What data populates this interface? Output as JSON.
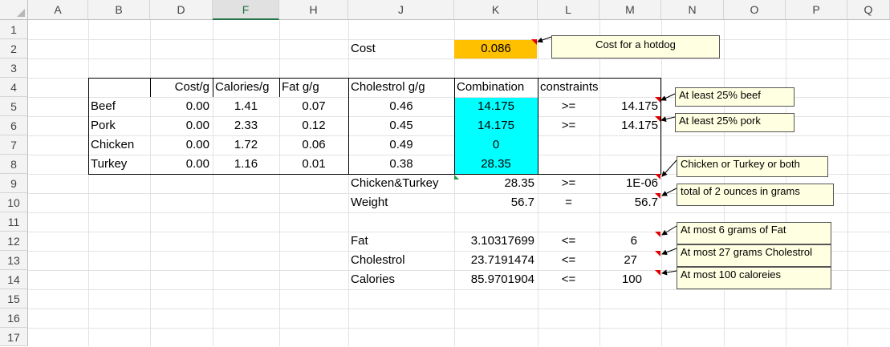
{
  "columns": [
    "A",
    "B",
    "D",
    "F",
    "H",
    "J",
    "K",
    "L",
    "M",
    "N",
    "O",
    "P",
    "Q"
  ],
  "rows": [
    "1",
    "2",
    "3",
    "4",
    "5",
    "6",
    "7",
    "8",
    "9",
    "10",
    "11",
    "12",
    "13",
    "14",
    "15",
    "16",
    "17"
  ],
  "cost": {
    "label": "Cost",
    "value": "0.086",
    "fill": "#ffc000"
  },
  "table": {
    "headers": {
      "cost": "Cost/g",
      "cal": "Calories/g",
      "fat": "Fat g/g",
      "chol": "Cholestrol g/g",
      "comb": "Combination",
      "cons": "constraints"
    },
    "rows": [
      {
        "name": "Beef",
        "cost": "0.00",
        "cal": "1.41",
        "fat": "0.07",
        "chol": "0.46",
        "comb": "14.175",
        "op": ">=",
        "rhs": "14.175"
      },
      {
        "name": "Pork",
        "cost": "0.00",
        "cal": "2.33",
        "fat": "0.12",
        "chol": "0.45",
        "comb": "14.175",
        "op": ">=",
        "rhs": "14.175"
      },
      {
        "name": "Chicken",
        "cost": "0.00",
        "cal": "1.72",
        "fat": "0.06",
        "chol": "0.49",
        "comb": "0",
        "op": "",
        "rhs": ""
      },
      {
        "name": "Turkey",
        "cost": "0.00",
        "cal": "1.16",
        "fat": "0.01",
        "chol": "0.38",
        "comb": "28.35",
        "op": "",
        "rhs": ""
      }
    ],
    "comb_fill": "#00ffff"
  },
  "constraints": {
    "chicken_turkey": {
      "label": "Chicken&Turkey",
      "value": "28.35",
      "op": ">=",
      "rhs": "1E-06"
    },
    "weight": {
      "label": "Weight",
      "value": "56.7",
      "op": "=",
      "rhs": "56.7"
    },
    "fat": {
      "label": "Fat",
      "value": "3.10317699",
      "op": "<=",
      "rhs": "6"
    },
    "cholestrol": {
      "label": "Cholestrol",
      "value": "23.7191474",
      "op": "<=",
      "rhs": "27"
    },
    "calories": {
      "label": "Calories",
      "value": "85.9701904",
      "op": "<=",
      "rhs": "100"
    }
  },
  "comments": {
    "cost": "Cost for a hotdog",
    "beef": "At least 25% beef",
    "pork": "At least 25% pork",
    "chicken_turkey": "Chicken or Turkey or both",
    "weight": "total of 2 ounces in grams",
    "fat": "At most 6 grams of Fat",
    "cholestrol": "At most 27 grams Cholestrol",
    "calories": "At most 100 caloreies"
  },
  "colors": {
    "header_bg": "#f3f3f3",
    "selected_col": "#217346",
    "note_bg": "#ffffe1"
  }
}
